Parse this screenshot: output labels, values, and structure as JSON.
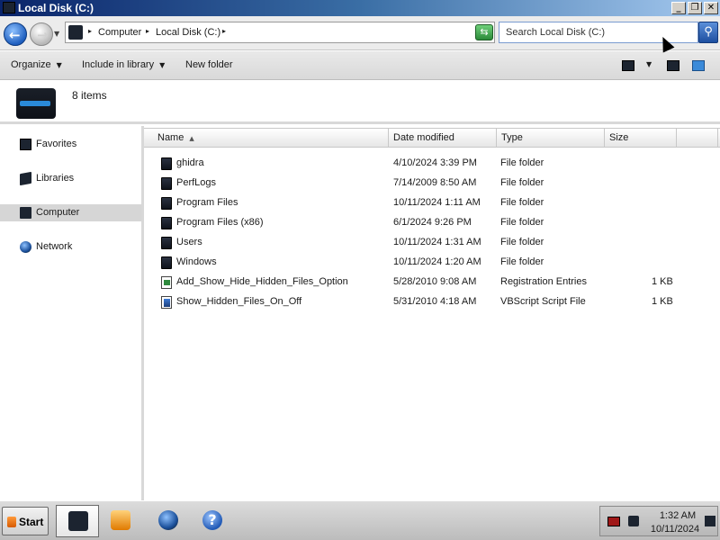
{
  "window": {
    "title": "Local Disk (C:)",
    "controls": {
      "minimize": "_",
      "maximize": "❐",
      "close": "✕"
    }
  },
  "nav": {
    "back_icon": "back-arrow-icon",
    "forward_icon": "forward-arrow-icon"
  },
  "address": {
    "breadcrumbs": [
      "Computer",
      "Local Disk (C:)"
    ]
  },
  "search": {
    "placeholder": "Search Local Disk (C:)"
  },
  "toolbar": {
    "organize": "Organize",
    "include_in_library": "Include in library",
    "new_folder": "New folder"
  },
  "details": {
    "item_count": "8 items"
  },
  "sidebar": {
    "items": [
      {
        "label": "Favorites",
        "icon": "favorites-icon",
        "selected": false
      },
      {
        "label": "Libraries",
        "icon": "libraries-icon",
        "selected": false
      },
      {
        "label": "Computer",
        "icon": "computer-icon",
        "selected": true
      },
      {
        "label": "Network",
        "icon": "network-icon",
        "selected": false
      }
    ]
  },
  "columns": {
    "name": "Name",
    "date_modified": "Date modified",
    "type": "Type",
    "size": "Size"
  },
  "files": [
    {
      "name": "ghidra",
      "date": "4/10/2024 3:39 PM",
      "type": "File folder",
      "size": "",
      "icon": "folder-icon"
    },
    {
      "name": "PerfLogs",
      "date": "7/14/2009 8:50 AM",
      "type": "File folder",
      "size": "",
      "icon": "folder-icon"
    },
    {
      "name": "Program Files",
      "date": "10/11/2024 1:11 AM",
      "type": "File folder",
      "size": "",
      "icon": "folder-icon"
    },
    {
      "name": "Program Files (x86)",
      "date": "6/1/2024 9:26 PM",
      "type": "File folder",
      "size": "",
      "icon": "folder-icon"
    },
    {
      "name": "Users",
      "date": "10/11/2024 1:31 AM",
      "type": "File folder",
      "size": "",
      "icon": "folder-icon"
    },
    {
      "name": "Windows",
      "date": "10/11/2024 1:20 AM",
      "type": "File folder",
      "size": "",
      "icon": "folder-icon"
    },
    {
      "name": "Add_Show_Hide_Hidden_Files_Option",
      "date": "5/28/2010 9:08 AM",
      "type": "Registration Entries",
      "size": "1 KB",
      "icon": "registry-file-icon"
    },
    {
      "name": "Show_Hidden_Files_On_Off",
      "date": "5/31/2010 4:18 AM",
      "type": "VBScript Script File",
      "size": "1 KB",
      "icon": "vbscript-file-icon"
    }
  ],
  "taskbar": {
    "start_label": "Start",
    "apps": [
      "explorer-icon",
      "media-player-icon",
      "internet-explorer-icon",
      "help-icon"
    ],
    "help_glyph": "?",
    "clock_time": "1:32 AM",
    "clock_date": "10/11/2024"
  }
}
